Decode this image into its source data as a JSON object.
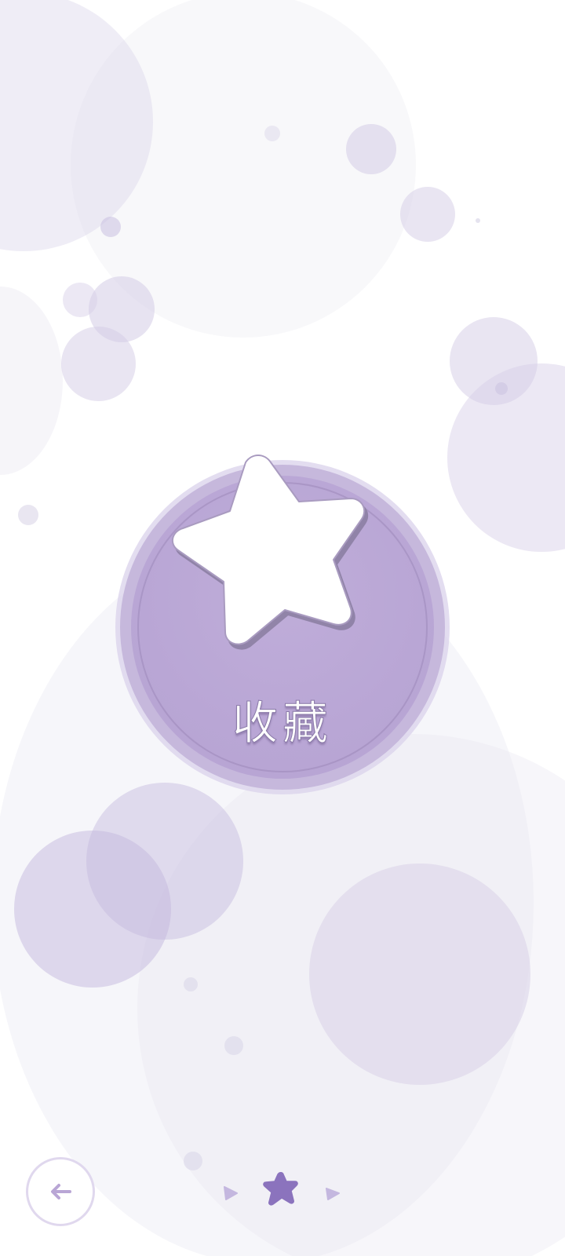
{
  "screen": {
    "background_color": "#ffffff",
    "accent_color": "#b9a6d5",
    "accent_dark": "#8b73bd"
  },
  "main_button": {
    "label": "收藏",
    "icon": "star-icon",
    "badge_color": "#b9a6d5",
    "star_fill": "#ffffff"
  },
  "navigation": {
    "back_icon": "arrow-left-icon",
    "back_icon_color": "#b9a6d5",
    "pager": {
      "prev_icon": "triangle-left-icon",
      "current_icon": "star-icon",
      "next_icon": "triangle-right-icon",
      "current_color": "#8b73bd",
      "inactive_color": "#c4b7df"
    }
  }
}
